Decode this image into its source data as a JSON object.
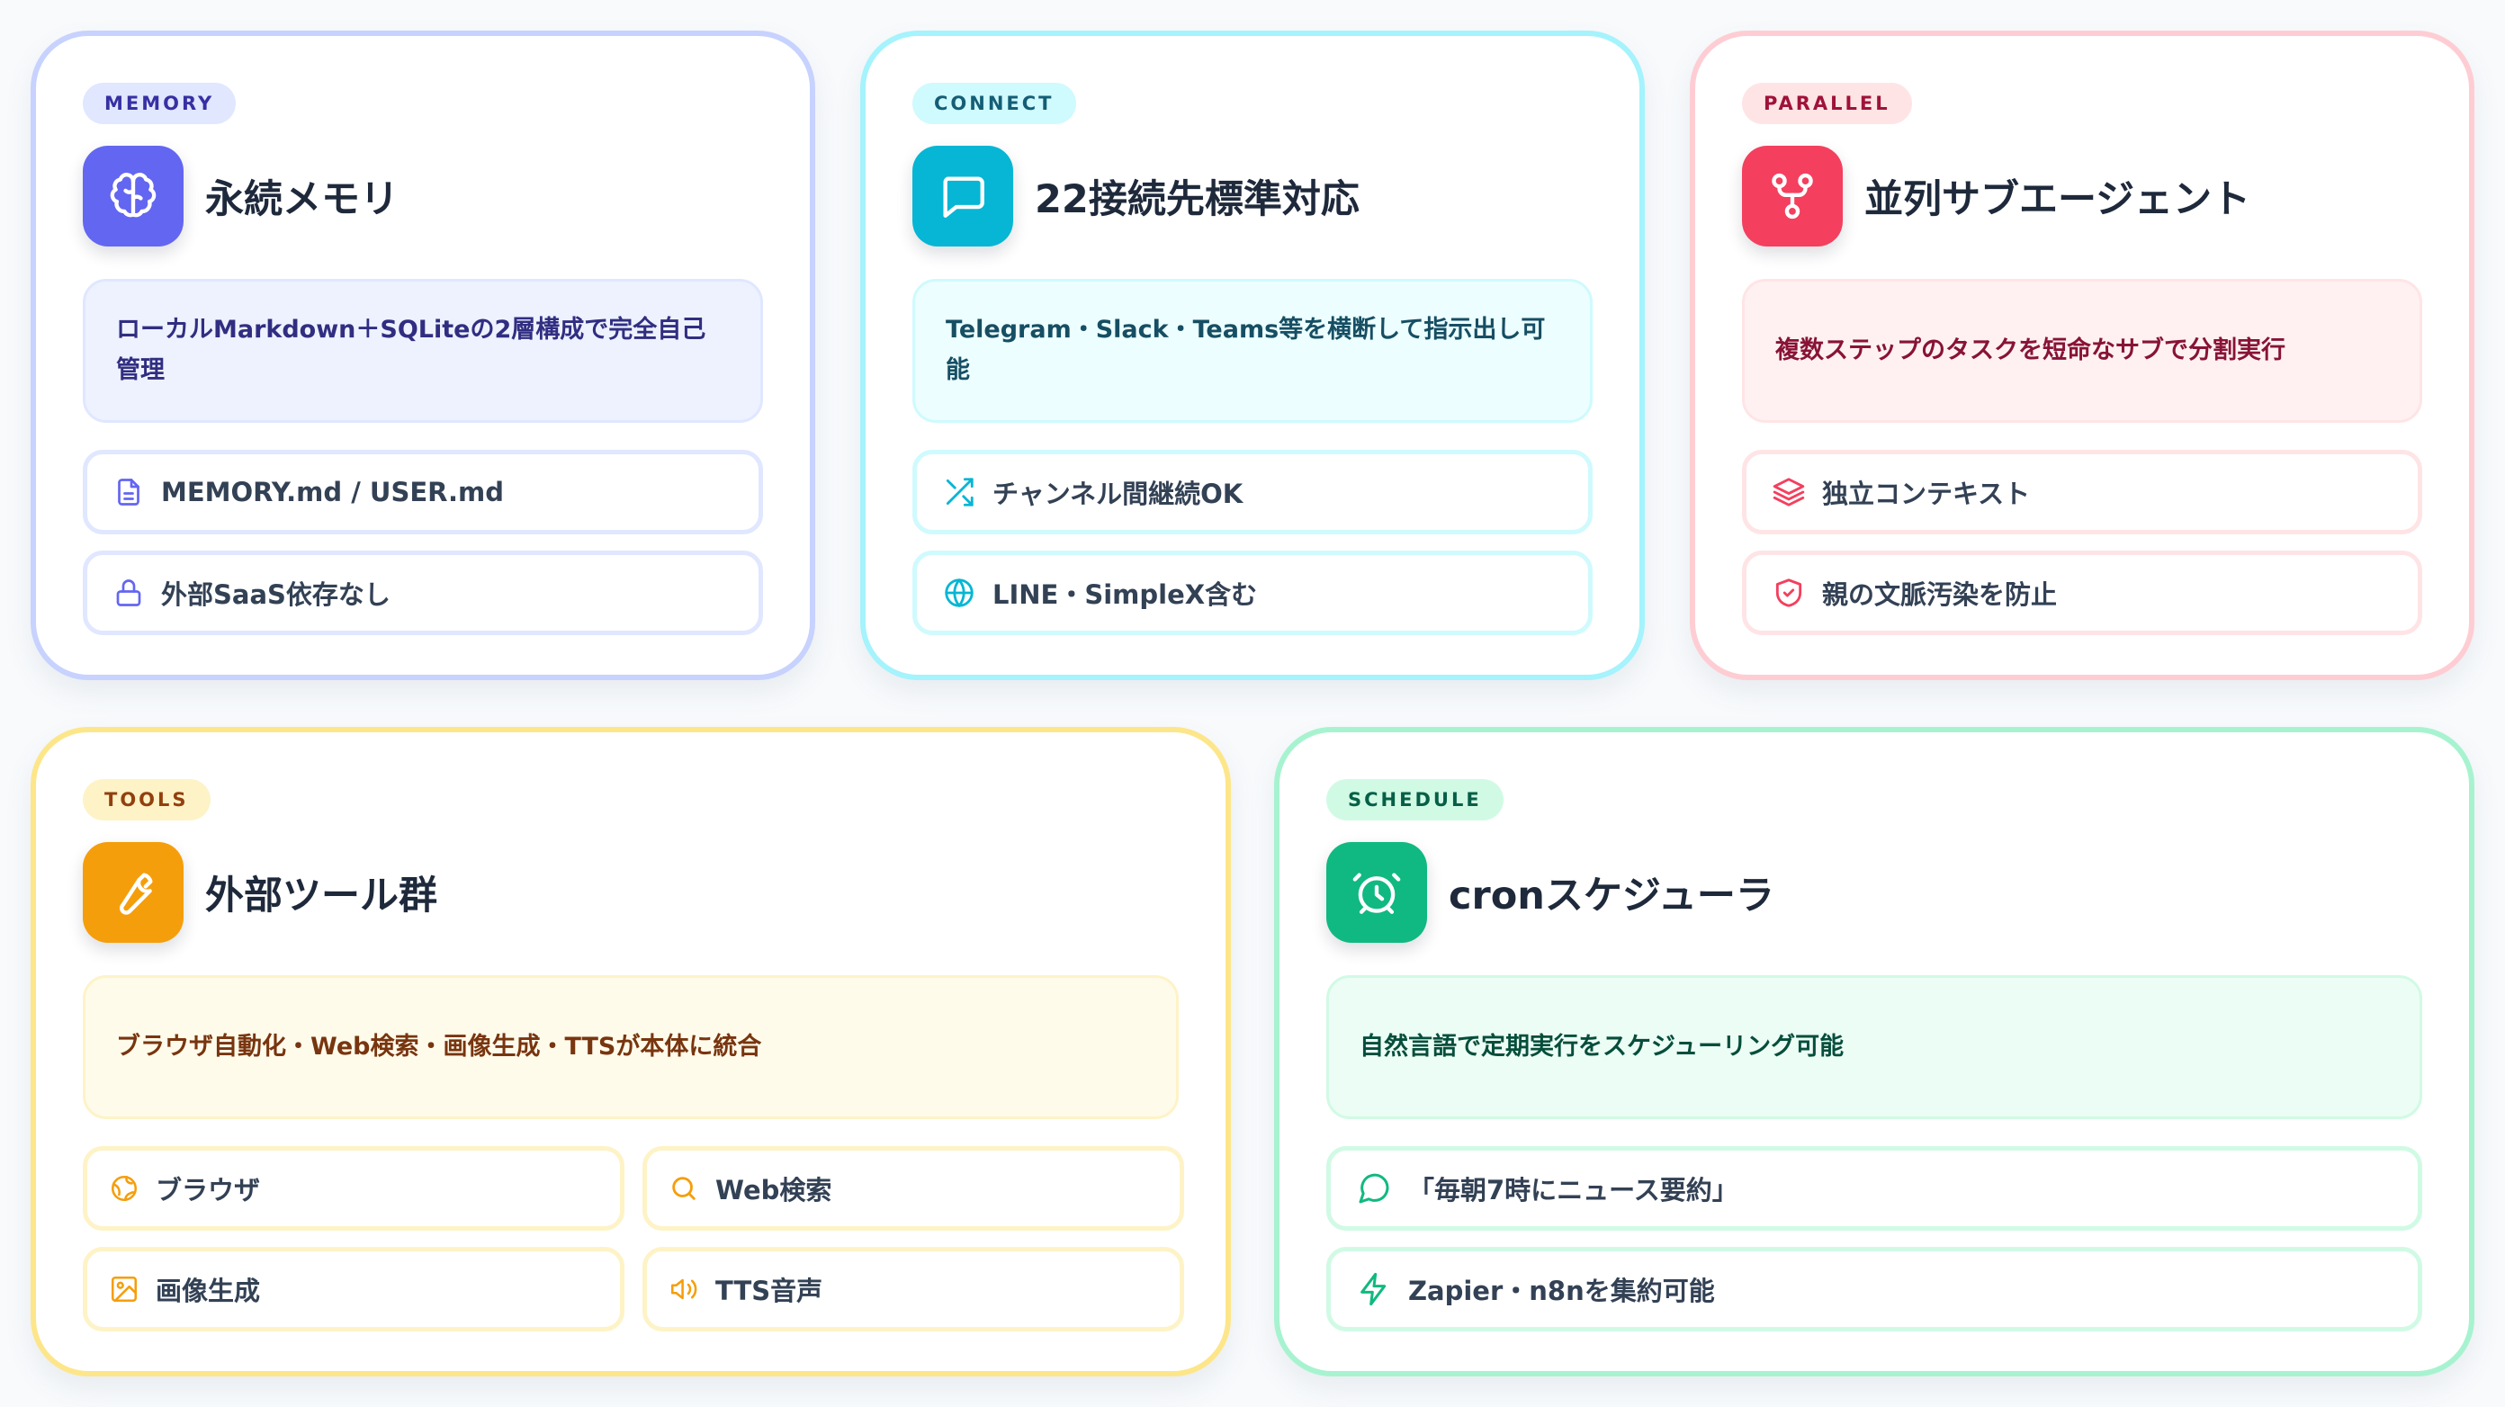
{
  "cards": [
    {
      "badge": "MEMORY",
      "icon": "brain-icon",
      "title": "永続メモリ",
      "desc": "ローカルMarkdown＋SQLiteの2層構成で完全自己管理",
      "items": [
        {
          "icon": "file-icon",
          "label": "MEMORY.md / USER.md"
        },
        {
          "icon": "lock-icon",
          "label": "外部SaaS依存なし"
        }
      ],
      "colors": {
        "border": "#c7d2fe",
        "accent": "#6366f1",
        "badge_bg": "#e0e7ff",
        "badge_text": "#3730a3",
        "desc_bg": "#eef2ff",
        "desc_text": "#312e81",
        "item_border": "#e0e7ff"
      }
    },
    {
      "badge": "CONNECT",
      "icon": "chat-bubble-icon",
      "title": "22接続先標準対応",
      "desc": "Telegram・Slack・Teams等を横断して指示出し可能",
      "items": [
        {
          "icon": "shuffle-icon",
          "label": "チャンネル間継続OK"
        },
        {
          "icon": "globe-icon",
          "label": "LINE・SimpleX含む"
        }
      ],
      "colors": {
        "border": "#a5f3fc",
        "accent": "#06b6d4",
        "badge_bg": "#cffafe",
        "badge_text": "#155e75",
        "desc_bg": "#ecfeff",
        "desc_text": "#164e63",
        "item_border": "#cffafe"
      }
    },
    {
      "badge": "PARALLEL",
      "icon": "git-fork-icon",
      "title": "並列サブエージェント",
      "desc": "複数ステップのタスクを短命なサブで分割実行",
      "items": [
        {
          "icon": "layers-icon",
          "label": "独立コンテキスト"
        },
        {
          "icon": "shield-check-icon",
          "label": "親の文脈汚染を防止"
        }
      ],
      "colors": {
        "border": "#fecdd3",
        "accent": "#f43f5e",
        "badge_bg": "#ffe4e6",
        "badge_text": "#9f1239",
        "desc_bg": "#fff1f2",
        "desc_text": "#881337",
        "item_border": "#ffe4e6"
      }
    },
    {
      "badge": "TOOLS",
      "icon": "wrench-icon",
      "title": "外部ツール群",
      "desc": "ブラウザ自動化・Web検索・画像生成・TTSが本体に統合",
      "items": [
        {
          "icon": "globe-alt-icon",
          "label": "ブラウザ"
        },
        {
          "icon": "search-icon",
          "label": "Web検索"
        },
        {
          "icon": "image-icon",
          "label": "画像生成"
        },
        {
          "icon": "speaker-icon",
          "label": "TTS音声"
        }
      ],
      "colors": {
        "border": "#fde68a",
        "accent": "#f59e0b",
        "badge_bg": "#fef3c7",
        "badge_text": "#92400e",
        "desc_bg": "#fffbeb",
        "desc_text": "#78350f",
        "item_border": "#fef3c7"
      }
    },
    {
      "badge": "SCHEDULE",
      "icon": "alarm-clock-icon",
      "title": "cronスケジューラ",
      "desc": "自然言語で定期実行をスケジューリング可能",
      "items": [
        {
          "icon": "message-circle-icon",
          "label": "「毎朝7時にニュース要約」"
        },
        {
          "icon": "zap-icon",
          "label": "Zapier・n8nを集約可能"
        }
      ],
      "colors": {
        "border": "#a7f3d0",
        "accent": "#10b981",
        "badge_bg": "#d1fae5",
        "badge_text": "#065f46",
        "desc_bg": "#ecfdf5",
        "desc_text": "#064e3b",
        "item_border": "#d1fae5"
      }
    }
  ]
}
